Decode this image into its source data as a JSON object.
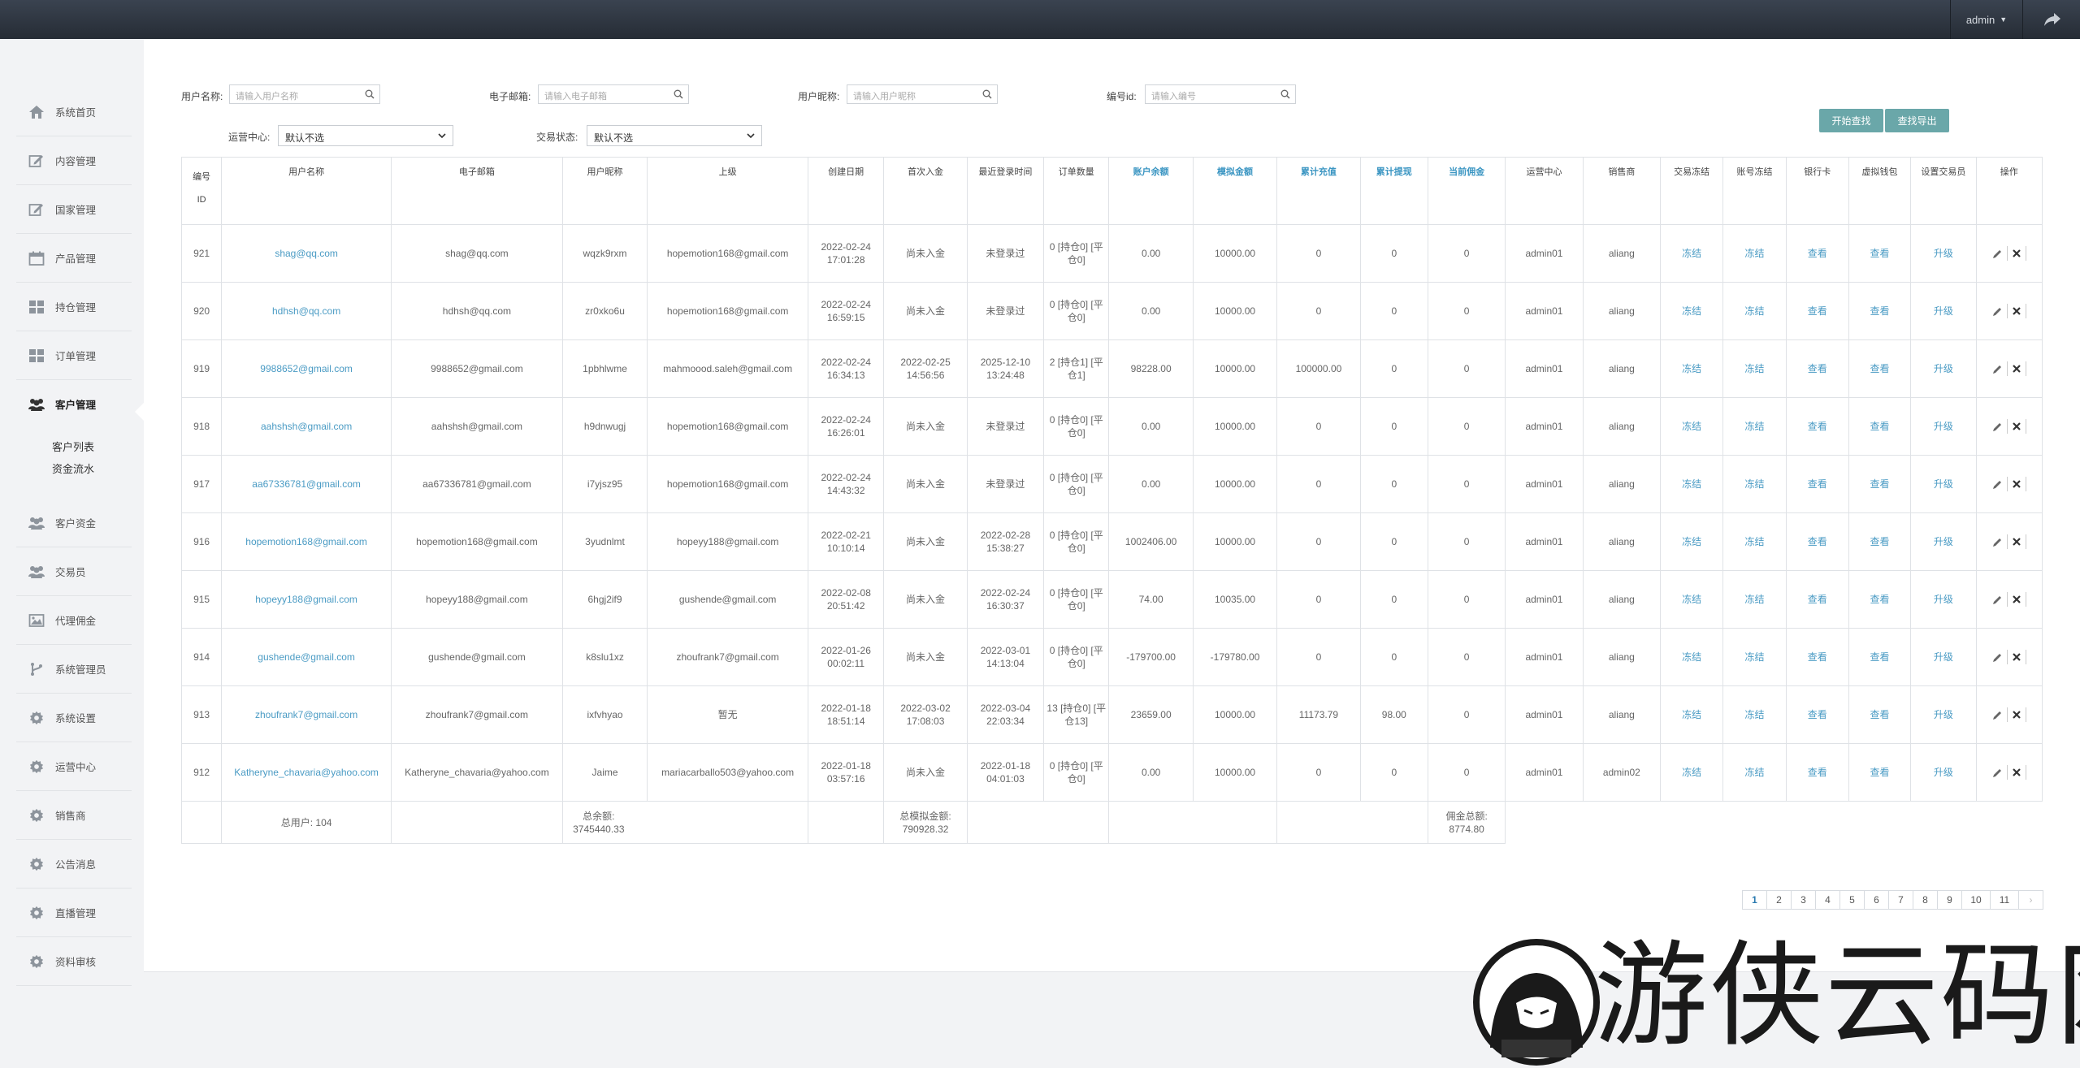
{
  "topbar": {
    "user": "admin"
  },
  "sidebar": {
    "items": [
      {
        "label": "系统首页",
        "icon": "home-icon"
      },
      {
        "label": "内容管理",
        "icon": "edit-icon"
      },
      {
        "label": "国家管理",
        "icon": "edit-icon"
      },
      {
        "label": "产品管理",
        "icon": "calendar-icon"
      },
      {
        "label": "持仓管理",
        "icon": "grid-icon"
      },
      {
        "label": "订单管理",
        "icon": "grid-icon"
      },
      {
        "label": "客户管理",
        "icon": "users-icon"
      },
      {
        "label": "客户资金",
        "icon": "users-icon"
      },
      {
        "label": "交易员",
        "icon": "users-icon"
      },
      {
        "label": "代理佣金",
        "icon": "image-icon"
      },
      {
        "label": "系统管理员",
        "icon": "branch-icon"
      },
      {
        "label": "系统设置",
        "icon": "gear-icon"
      },
      {
        "label": "运营中心",
        "icon": "gear-icon"
      },
      {
        "label": "销售商",
        "icon": "gear-icon"
      },
      {
        "label": "公告消息",
        "icon": "gear-icon"
      },
      {
        "label": "直播管理",
        "icon": "gear-icon"
      },
      {
        "label": "资料审核",
        "icon": "gear-icon"
      }
    ],
    "sub_items": [
      "客户列表",
      "资金流水"
    ]
  },
  "filters": {
    "username": {
      "label": "用户名称:",
      "placeholder": "请输入用户名称"
    },
    "email": {
      "label": "电子邮箱:",
      "placeholder": "请输入电子邮箱"
    },
    "nickname": {
      "label": "用户昵称:",
      "placeholder": "请输入用户昵称"
    },
    "id": {
      "label": "编号id:",
      "placeholder": "请输入编号"
    },
    "ops_center": {
      "label": "运营中心:",
      "value": "默认不选"
    },
    "trade_status": {
      "label": "交易状态:",
      "value": "默认不选"
    },
    "search_button": "开始查找",
    "export_button": "查找导出"
  },
  "table": {
    "headers": [
      {
        "text": "编号\nID",
        "blue": false
      },
      {
        "text": "用户名称",
        "blue": false
      },
      {
        "text": "电子邮箱",
        "blue": false
      },
      {
        "text": "用户昵称",
        "blue": false
      },
      {
        "text": "上级",
        "blue": false
      },
      {
        "text": "创建日期",
        "blue": false
      },
      {
        "text": "首次入金",
        "blue": false
      },
      {
        "text": "最近登录时间",
        "blue": false
      },
      {
        "text": "订单数量",
        "blue": false
      },
      {
        "text": "账户余额",
        "blue": true
      },
      {
        "text": "模拟金额",
        "blue": true
      },
      {
        "text": "累计充值",
        "blue": true
      },
      {
        "text": "累计提现",
        "blue": true
      },
      {
        "text": "当前佣金",
        "blue": true
      },
      {
        "text": "运营中心",
        "blue": false
      },
      {
        "text": "销售商",
        "blue": false
      },
      {
        "text": "交易冻结",
        "blue": false
      },
      {
        "text": "账号冻结",
        "blue": false
      },
      {
        "text": "银行卡",
        "blue": false
      },
      {
        "text": "虚拟钱包",
        "blue": false
      },
      {
        "text": "设置交易员",
        "blue": false
      },
      {
        "text": "操作",
        "blue": false
      }
    ],
    "rows": [
      [
        "921",
        "shag@qq.com",
        "shag@qq.com",
        "wqzk9rxm",
        "hopemotion168@gmail.com",
        "2022-02-24 17:01:28",
        "尚未入金",
        "未登录过",
        "0 [持仓0] [平仓0]",
        "0.00",
        "10000.00",
        "0",
        "0",
        "0",
        "admin01",
        "aliang",
        "冻结",
        "冻结",
        "查看",
        "查看",
        "升级"
      ],
      [
        "920",
        "hdhsh@qq.com",
        "hdhsh@qq.com",
        "zr0xko6u",
        "hopemotion168@gmail.com",
        "2022-02-24 16:59:15",
        "尚未入金",
        "未登录过",
        "0 [持仓0] [平仓0]",
        "0.00",
        "10000.00",
        "0",
        "0",
        "0",
        "admin01",
        "aliang",
        "冻结",
        "冻结",
        "查看",
        "查看",
        "升级"
      ],
      [
        "919",
        "9988652@gmail.com",
        "9988652@gmail.com",
        "1pbhlwme",
        "mahmoood.saleh@gmail.com",
        "2022-02-24 16:34:13",
        "2022-02-25 14:56:56",
        "2025-12-10 13:24:48",
        "2 [持仓1] [平仓1]",
        "98228.00",
        "10000.00",
        "100000.00",
        "0",
        "0",
        "admin01",
        "aliang",
        "冻结",
        "冻结",
        "查看",
        "查看",
        "升级"
      ],
      [
        "918",
        "aahshsh@gmail.com",
        "aahshsh@gmail.com",
        "h9dnwugj",
        "hopemotion168@gmail.com",
        "2022-02-24 16:26:01",
        "尚未入金",
        "未登录过",
        "0 [持仓0] [平仓0]",
        "0.00",
        "10000.00",
        "0",
        "0",
        "0",
        "admin01",
        "aliang",
        "冻结",
        "冻结",
        "查看",
        "查看",
        "升级"
      ],
      [
        "917",
        "aa67336781@gmail.com",
        "aa67336781@gmail.com",
        "i7yjsz95",
        "hopemotion168@gmail.com",
        "2022-02-24 14:43:32",
        "尚未入金",
        "未登录过",
        "0 [持仓0] [平仓0]",
        "0.00",
        "10000.00",
        "0",
        "0",
        "0",
        "admin01",
        "aliang",
        "冻结",
        "冻结",
        "查看",
        "查看",
        "升级"
      ],
      [
        "916",
        "hopemotion168@gmail.com",
        "hopemotion168@gmail.com",
        "3yudnlmt",
        "hopeyy188@gmail.com",
        "2022-02-21 10:10:14",
        "尚未入金",
        "2022-02-28 15:38:27",
        "0 [持仓0] [平仓0]",
        "1002406.00",
        "10000.00",
        "0",
        "0",
        "0",
        "admin01",
        "aliang",
        "冻结",
        "冻结",
        "查看",
        "查看",
        "升级"
      ],
      [
        "915",
        "hopeyy188@gmail.com",
        "hopeyy188@gmail.com",
        "6hgj2if9",
        "gushende@gmail.com",
        "2022-02-08 20:51:42",
        "尚未入金",
        "2022-02-24 16:30:37",
        "0 [持仓0] [平仓0]",
        "74.00",
        "10035.00",
        "0",
        "0",
        "0",
        "admin01",
        "aliang",
        "冻结",
        "冻结",
        "查看",
        "查看",
        "升级"
      ],
      [
        "914",
        "gushende@gmail.com",
        "gushende@gmail.com",
        "k8slu1xz",
        "zhoufrank7@gmail.com",
        "2022-01-26 00:02:11",
        "尚未入金",
        "2022-03-01 14:13:04",
        "0 [持仓0] [平仓0]",
        "-179700.00",
        "-179780.00",
        "0",
        "0",
        "0",
        "admin01",
        "aliang",
        "冻结",
        "冻结",
        "查看",
        "查看",
        "升级"
      ],
      [
        "913",
        "zhoufrank7@gmail.com",
        "zhoufrank7@gmail.com",
        "ixfvhyao",
        "暂无",
        "2022-01-18 18:51:14",
        "2022-03-02 17:08:03",
        "2022-03-04 22:03:34",
        "13 [持仓0] [平仓13]",
        "23659.00",
        "10000.00",
        "11173.79",
        "98.00",
        "0",
        "admin01",
        "aliang",
        "冻结",
        "冻结",
        "查看",
        "查看",
        "升级"
      ],
      [
        "912",
        "Katheryne_chavaria@yahoo.com",
        "Katheryne_chavaria@yahoo.com",
        "Jaime",
        "mariacarballo503@yahoo.com",
        "2022-01-18 03:57:16",
        "尚未入金",
        "2022-01-18 04:01:03",
        "0 [持仓0] [平仓0]",
        "0.00",
        "10000.00",
        "0",
        "0",
        "0",
        "admin01",
        "admin02",
        "冻结",
        "冻结",
        "查看",
        "查看",
        "升级"
      ]
    ],
    "footer": {
      "total_users": "总用户: 104",
      "total_balance": "总余额: 3745440.33",
      "total_sim": "总模拟金额: 790928.32",
      "total_commission": "佣金总额: 8774.80"
    }
  },
  "pager": {
    "pages": [
      "1",
      "2",
      "3",
      "4",
      "5",
      "6",
      "7",
      "8",
      "9",
      "10",
      "11"
    ],
    "next": "›",
    "current": "1"
  },
  "watermark": {
    "text": "游侠云码网"
  },
  "colors": {
    "topbar": "#2d333c",
    "accent": "#6aa7a9",
    "link": "#4a9bc4"
  }
}
